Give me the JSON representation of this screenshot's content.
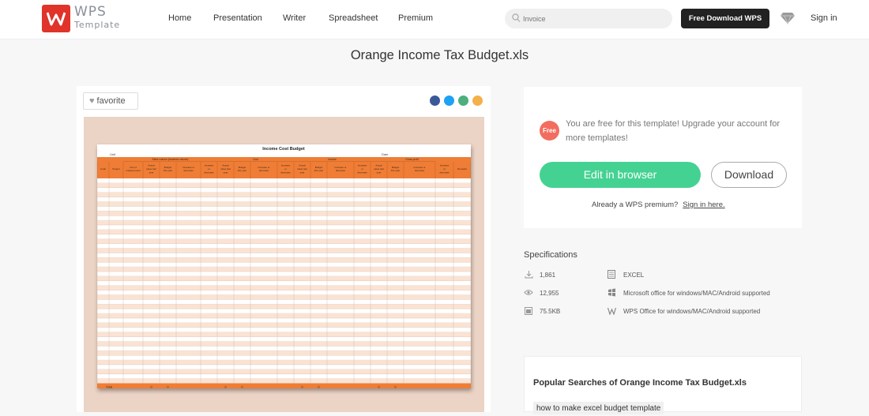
{
  "header": {
    "brand_top": "WPS",
    "brand_bottom": "Template",
    "nav": [
      "Home",
      "Presentation",
      "Writer",
      "Spreadsheet",
      "Premium"
    ],
    "search_placeholder": "Invoice",
    "download_label": "Free Download WPS",
    "signin_label": "Sign in"
  },
  "page": {
    "title": "Orange Income Tax Budget.xls"
  },
  "left": {
    "favorite_label": "favorite",
    "share_icons": [
      {
        "name": "facebook-icon",
        "color": "#3b5998"
      },
      {
        "name": "twitter-icon",
        "color": "#1da1f2"
      },
      {
        "name": "email-icon",
        "color": "#4caf7d"
      },
      {
        "name": "link-icon",
        "color": "#f4b04a"
      }
    ]
  },
  "sheet": {
    "title": "Income Cost Budget",
    "unit_label": "Unit",
    "date_label": "Date",
    "total_label": "Total",
    "group_headers": [
      "Sales volume (business volume)",
      "Cost",
      "Income",
      "Gross profit"
    ],
    "columns": [
      "Code",
      "Project",
      "Unit of measurement",
      "Actual value last year",
      "Budget this year",
      "Increase or decrease",
      "Increase or decrease rate (%)",
      "Actual value last year",
      "Budget this year",
      "Increase or decrease",
      "Increase or decrease rate (%)",
      "Actual value last year",
      "Budget this year",
      "Increase or decrease",
      "Increase or decrease rate (%)",
      "Actual value last year",
      "Budget this year",
      "Increase or decrease",
      "Increase or decrease rate (%)",
      "Remarks"
    ],
    "total_values": [
      "",
      "",
      "",
      "0",
      "0",
      "",
      "",
      "0",
      "0",
      "",
      "",
      "0",
      "0",
      "",
      "",
      "0",
      "0",
      "",
      "",
      ""
    ],
    "accent_color": "#ef7d35",
    "stripe_color": "#fbe3d3"
  },
  "right": {
    "free_badge": "Free",
    "free_text": "You are free for this template! Upgrade your account for more templates!",
    "edit_label": "Edit in browser",
    "download_label": "Download",
    "already_text": "Already a WPS premium?",
    "signin_here": "Sign in here.",
    "edit_color": "#44d292"
  },
  "specs": {
    "title": "Specifications",
    "downloads": "1,861",
    "views": "12,955",
    "size": "75.5KB",
    "format": "EXCEL",
    "support_1": "Microsoft office for windows/MAC/Android supported",
    "support_2": "WPS Office for windows/MAC/Android supported"
  },
  "popular": {
    "title": "Popular Searches of Orange Income Tax Budget.xls",
    "tags": [
      "how to make excel budget template"
    ]
  }
}
